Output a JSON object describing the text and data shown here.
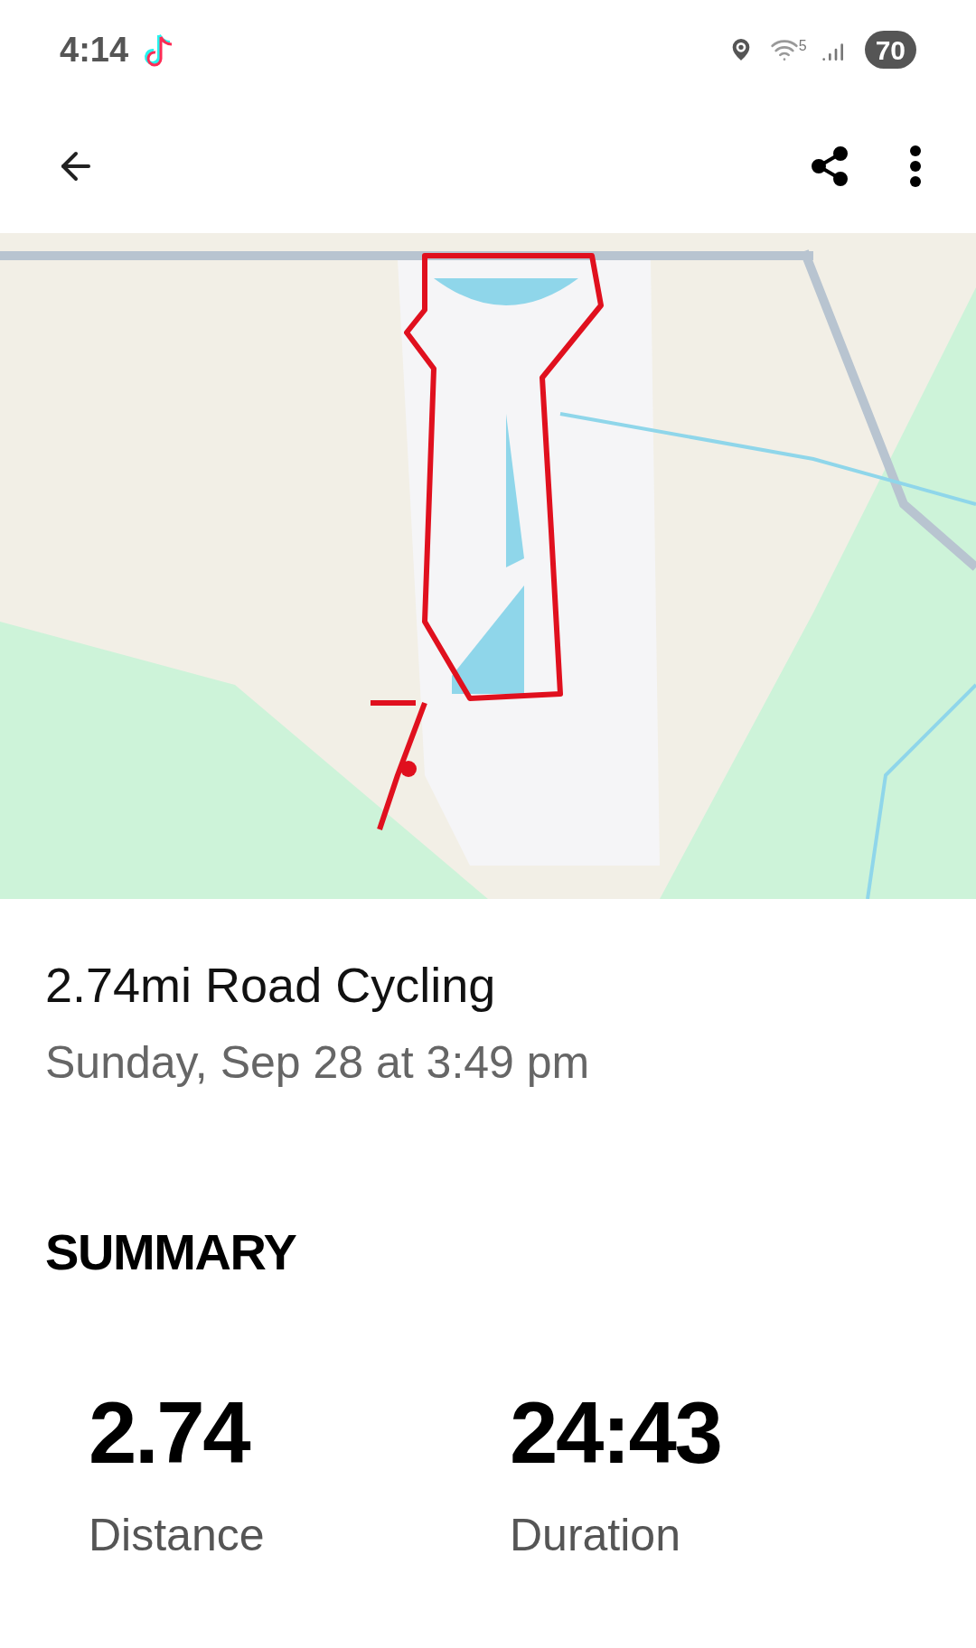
{
  "status_bar": {
    "time": "4:14",
    "network": "5",
    "battery": "70"
  },
  "activity": {
    "title": "2.74mi Road Cycling",
    "date": "Sunday, Sep 28 at 3:49 pm"
  },
  "summary": {
    "heading": "SUMMARY",
    "stats": [
      {
        "value": "2.74",
        "label": "Distance"
      },
      {
        "value": "24:43",
        "label": "Duration"
      }
    ]
  }
}
